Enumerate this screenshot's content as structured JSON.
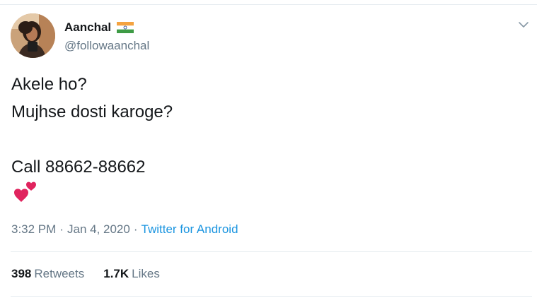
{
  "tweet": {
    "author": {
      "display_name": "Aanchal",
      "handle": "@followaanchal",
      "flag_icon": "india-flag-icon",
      "avatar_icon": "profile-photo"
    },
    "menu_icon": "chevron-down-icon",
    "body": {
      "line1": "Akele ho?",
      "line2": "Mujhse dosti karoge?",
      "line3": "Call 88662-88662",
      "emoji_icon": "two-hearts-icon"
    },
    "meta": {
      "time": "3:32 PM",
      "separator": "·",
      "date": "Jan 4, 2020",
      "separator2": "·",
      "source": "Twitter for Android"
    },
    "stats": {
      "retweets_count": "398",
      "retweets_label": "Retweets",
      "likes_count": "1.7K",
      "likes_label": "Likes"
    },
    "colors": {
      "text": "#14171a",
      "secondary": "#657786",
      "link": "#1b95e0",
      "heart": "#e0245e",
      "divider": "#e6ecf0"
    }
  }
}
